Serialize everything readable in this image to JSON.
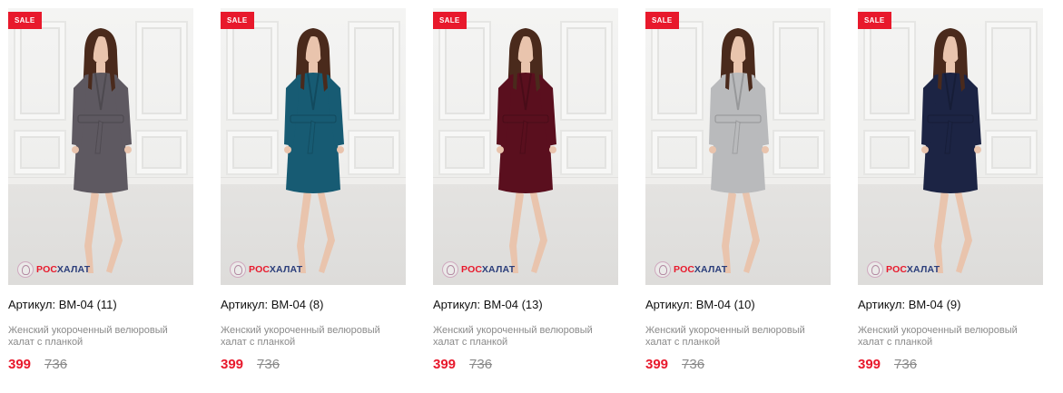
{
  "brand": {
    "logo_text_part1": "РОС",
    "logo_text_part2": "ХАЛАТ",
    "sale_color": "#e8192c"
  },
  "products": [
    {
      "badge": "SALE",
      "title": "Артикул: ВМ-04 (11)",
      "description": "Женский укороченный велюровый халат с планкой",
      "price": "399",
      "old_price": "736",
      "robe_color": "#5e5961"
    },
    {
      "badge": "SALE",
      "title": "Артикул: ВМ-04 (8)",
      "description": "Женский укороченный велюровый халат с планкой",
      "price": "399",
      "old_price": "736",
      "robe_color": "#175b73"
    },
    {
      "badge": "SALE",
      "title": "Артикул: ВМ-04 (13)",
      "description": "Женский укороченный велюровый халат с планкой",
      "price": "399",
      "old_price": "736",
      "robe_color": "#5a0f1e"
    },
    {
      "badge": "SALE",
      "title": "Артикул: ВМ-04 (10)",
      "description": "Женский укороченный велюровый халат с планкой",
      "price": "399",
      "old_price": "736",
      "robe_color": "#b9babc"
    },
    {
      "badge": "SALE",
      "title": "Артикул: ВМ-04 (9)",
      "description": "Женский укороченный велюровый халат с планкой",
      "price": "399",
      "old_price": "736",
      "robe_color": "#1c2444"
    }
  ]
}
